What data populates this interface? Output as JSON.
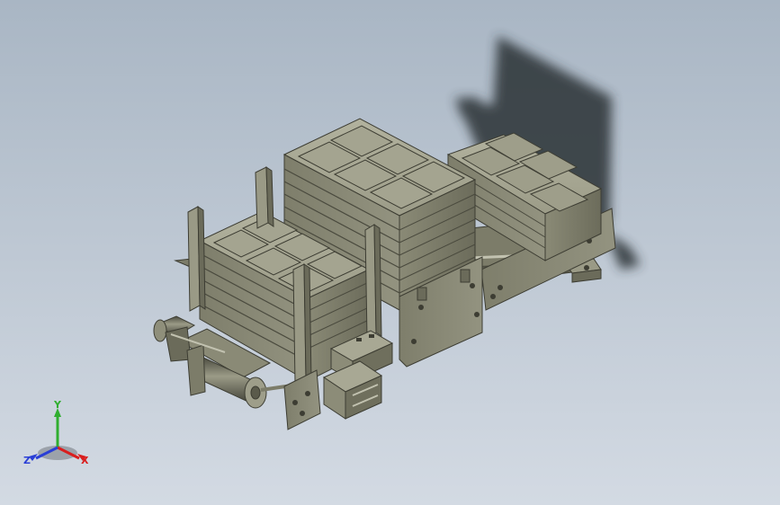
{
  "viewport": {
    "background_top": "#a9b6c4",
    "background_bottom": "#d3dae3"
  },
  "model": {
    "part_color": "#878773",
    "part_dark": "#5f5f50",
    "part_light": "#a6a692",
    "shadow_color": "#2b3036"
  },
  "triad": {
    "x_label": "X",
    "y_label": "Y",
    "z_label": "Z",
    "x_color": "#d91e1e",
    "y_color": "#2fae2f",
    "z_color": "#2a3fd6"
  }
}
